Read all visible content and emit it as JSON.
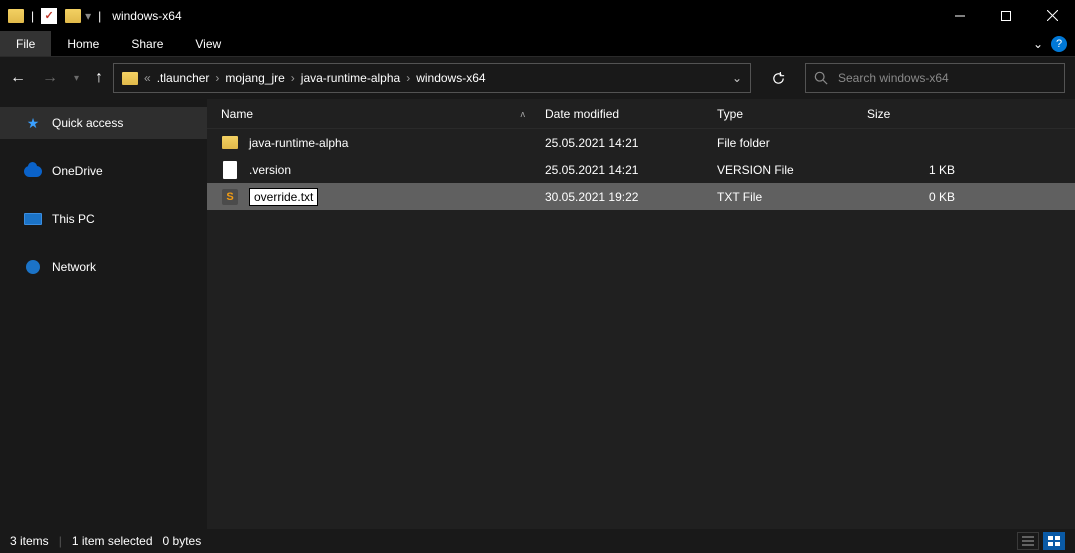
{
  "window": {
    "title": "windows-x64"
  },
  "ribbon": {
    "file": "File",
    "tabs": [
      "Home",
      "Share",
      "View"
    ]
  },
  "breadcrumbs": [
    ".tlauncher",
    "mojang_jre",
    "java-runtime-alpha",
    "windows-x64"
  ],
  "search": {
    "placeholder": "Search windows-x64"
  },
  "sidebar": {
    "items": [
      {
        "label": "Quick access",
        "icon": "star",
        "active": true
      },
      {
        "label": "OneDrive",
        "icon": "cloud",
        "active": false
      },
      {
        "label": "This PC",
        "icon": "pc",
        "active": false
      },
      {
        "label": "Network",
        "icon": "net",
        "active": false
      }
    ]
  },
  "columns": {
    "name": "Name",
    "date": "Date modified",
    "type": "Type",
    "size": "Size"
  },
  "rows": [
    {
      "icon": "folder",
      "name": "java-runtime-alpha",
      "date": "25.05.2021 14:21",
      "type": "File folder",
      "size": "",
      "selected": false,
      "editing": false
    },
    {
      "icon": "doc",
      "name": ".version",
      "date": "25.05.2021 14:21",
      "type": "VERSION File",
      "size": "1 KB",
      "selected": false,
      "editing": false
    },
    {
      "icon": "sublime",
      "name": "override.txt",
      "date": "30.05.2021 19:22",
      "type": "TXT File",
      "size": "0 KB",
      "selected": true,
      "editing": true
    }
  ],
  "status": {
    "items": "3 items",
    "selected": "1 item selected",
    "bytes": "0 bytes"
  }
}
